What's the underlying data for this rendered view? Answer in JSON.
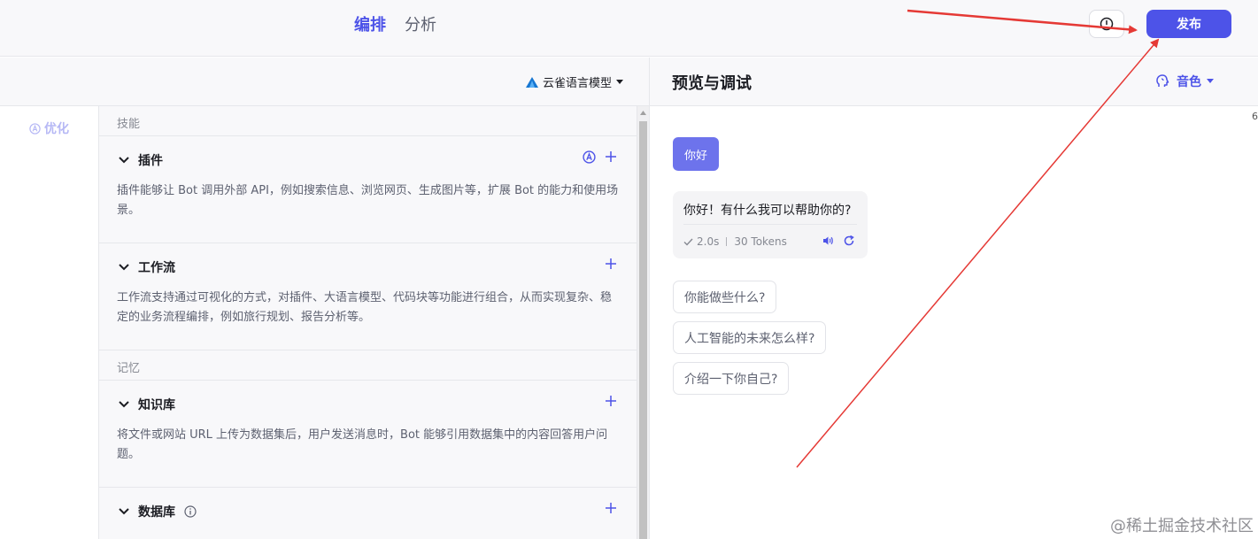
{
  "topbar": {
    "tabs": [
      {
        "label": "编排",
        "active": true
      },
      {
        "label": "分析",
        "active": false
      }
    ],
    "publish_label": "发布"
  },
  "config": {
    "model_label": "云雀语言模型",
    "optimize_label": "优化",
    "sections": [
      {
        "label": "技能"
      },
      {
        "label": "记忆"
      }
    ],
    "blocks": [
      {
        "title": "插件",
        "desc": "插件能够让 Bot 调用外部 API，例如搜索信息、浏览网页、生成图片等，扩展 Bot 的能力和使用场景。"
      },
      {
        "title": "工作流",
        "desc": "工作流支持通过可视化的方式，对插件、大语言模型、代码块等功能进行组合，从而实现复杂、稳定的业务流程编排，例如旅行规划、报告分析等。"
      },
      {
        "title": "知识库",
        "desc": "将文件或网站 URL 上传为数据集后，用户发送消息时，Bot 能够引用数据集中的内容回答用户问题。"
      },
      {
        "title": "数据库"
      }
    ]
  },
  "preview": {
    "title": "预览与调试",
    "voice_label": "音色",
    "user_message": "你好",
    "bot_message": "你好！有什么我可以帮助你的?",
    "bot_duration": "2.0s",
    "bot_tokens": "30 Tokens",
    "suggestions": [
      "你能做些什么?",
      "人工智能的未来怎么样?",
      "介绍一下你自己?"
    ]
  },
  "edge_char": "6",
  "watermark": "@稀土掘金技术社区",
  "colors": {
    "accent": "#4d53e8",
    "user_bubble": "#6d73ec",
    "annotation_arrow": "#e53935"
  }
}
